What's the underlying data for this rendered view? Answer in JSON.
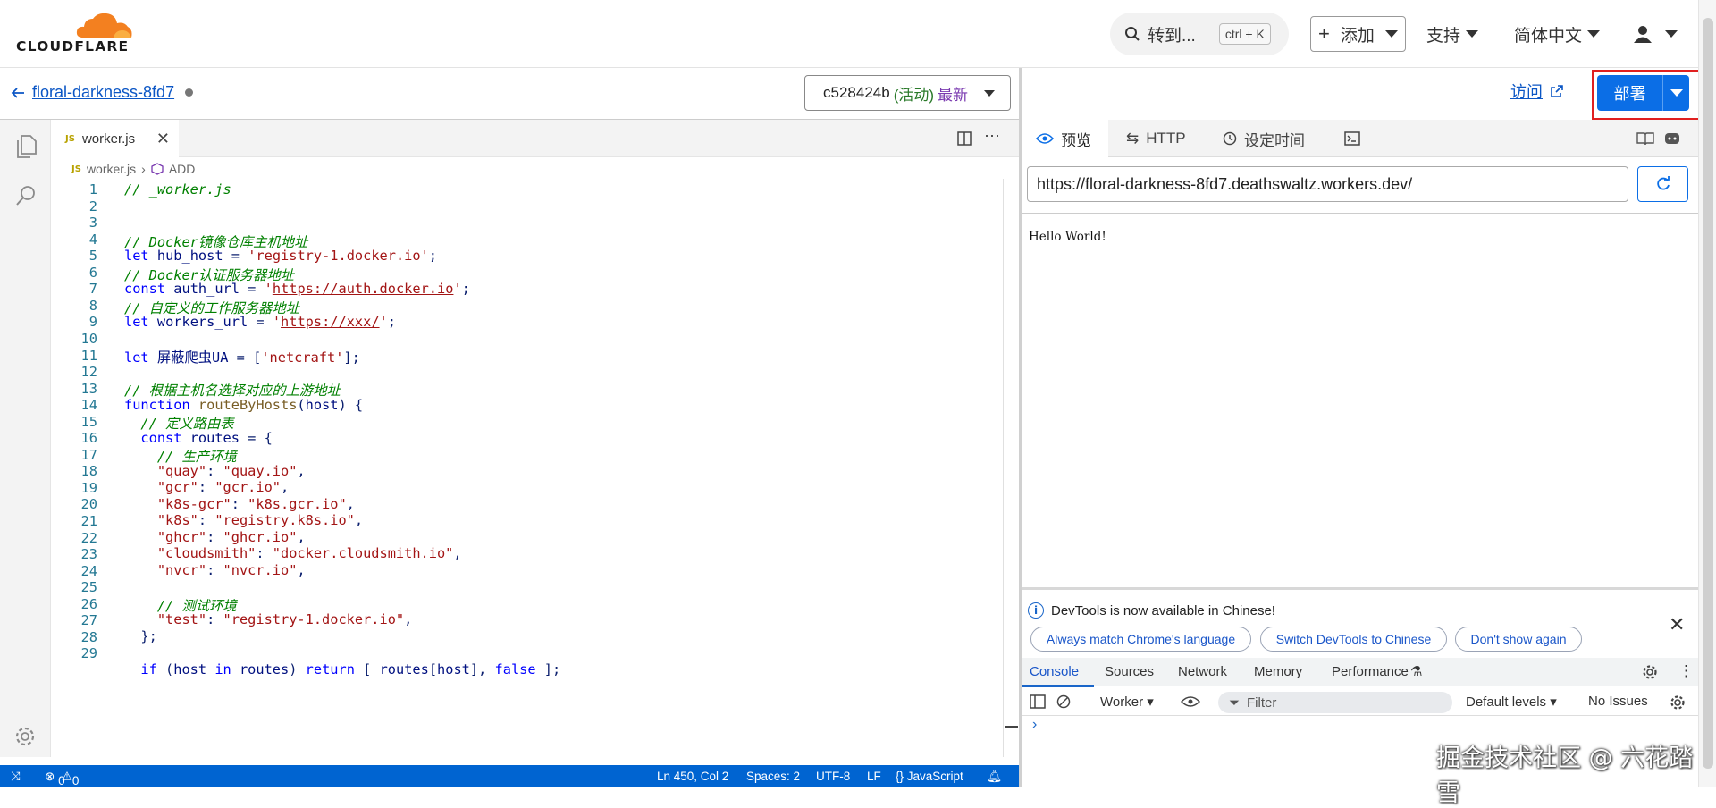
{
  "brand": {
    "name": "CLOUDFLARE",
    "accent": "#f38020"
  },
  "topbar": {
    "search_label": "转到...",
    "search_shortcut": "ctrl + K",
    "add_label": "添加",
    "support_label": "支持",
    "language_label": "简体中文"
  },
  "worker": {
    "name": "floral-darkness-8fd7",
    "version_id": "c528424b",
    "version_status": "(活动)",
    "version_latest": "最新"
  },
  "editor": {
    "tab_badge": "JS",
    "tab_name": "worker.js",
    "breadcrumb_file": "worker.js",
    "breadcrumb_symbol": "ADD",
    "lines": [
      "1",
      "2",
      "3",
      "4",
      "5",
      "6",
      "7",
      "8",
      "9",
      "10",
      "11",
      "12",
      "13",
      "14",
      "15",
      "16",
      "17",
      "18",
      "19",
      "20",
      "21",
      "22",
      "23",
      "24",
      "25",
      "26",
      "27",
      "28",
      "29"
    ]
  },
  "statusbar": {
    "problems_errors": "0",
    "problems_warnings": "0",
    "position": "Ln 450, Col 2",
    "spaces": "Spaces: 2",
    "encoding": "UTF-8",
    "eol": "LF",
    "language": "{} JavaScript"
  },
  "preview": {
    "visit_label": "访问",
    "deploy_label": "部署",
    "tabs": [
      "预览",
      "HTTP",
      "设定时间"
    ],
    "url": "https://floral-darkness-8fd7.deathswaltz.workers.dev/",
    "body_text": "Hello World!"
  },
  "devtools": {
    "message": "DevTools is now available in Chinese!",
    "buttons": [
      "Always match Chrome's language",
      "Switch DevTools to Chinese",
      "Don't show again"
    ],
    "tabs": [
      "Console",
      "Sources",
      "Network",
      "Memory",
      "Performance"
    ],
    "context": "Worker",
    "filter_placeholder": "Filter",
    "levels": "Default levels",
    "issues": "No Issues",
    "prompt": "›"
  },
  "watermark": "掘金技术社区 @ 六花踏雪"
}
